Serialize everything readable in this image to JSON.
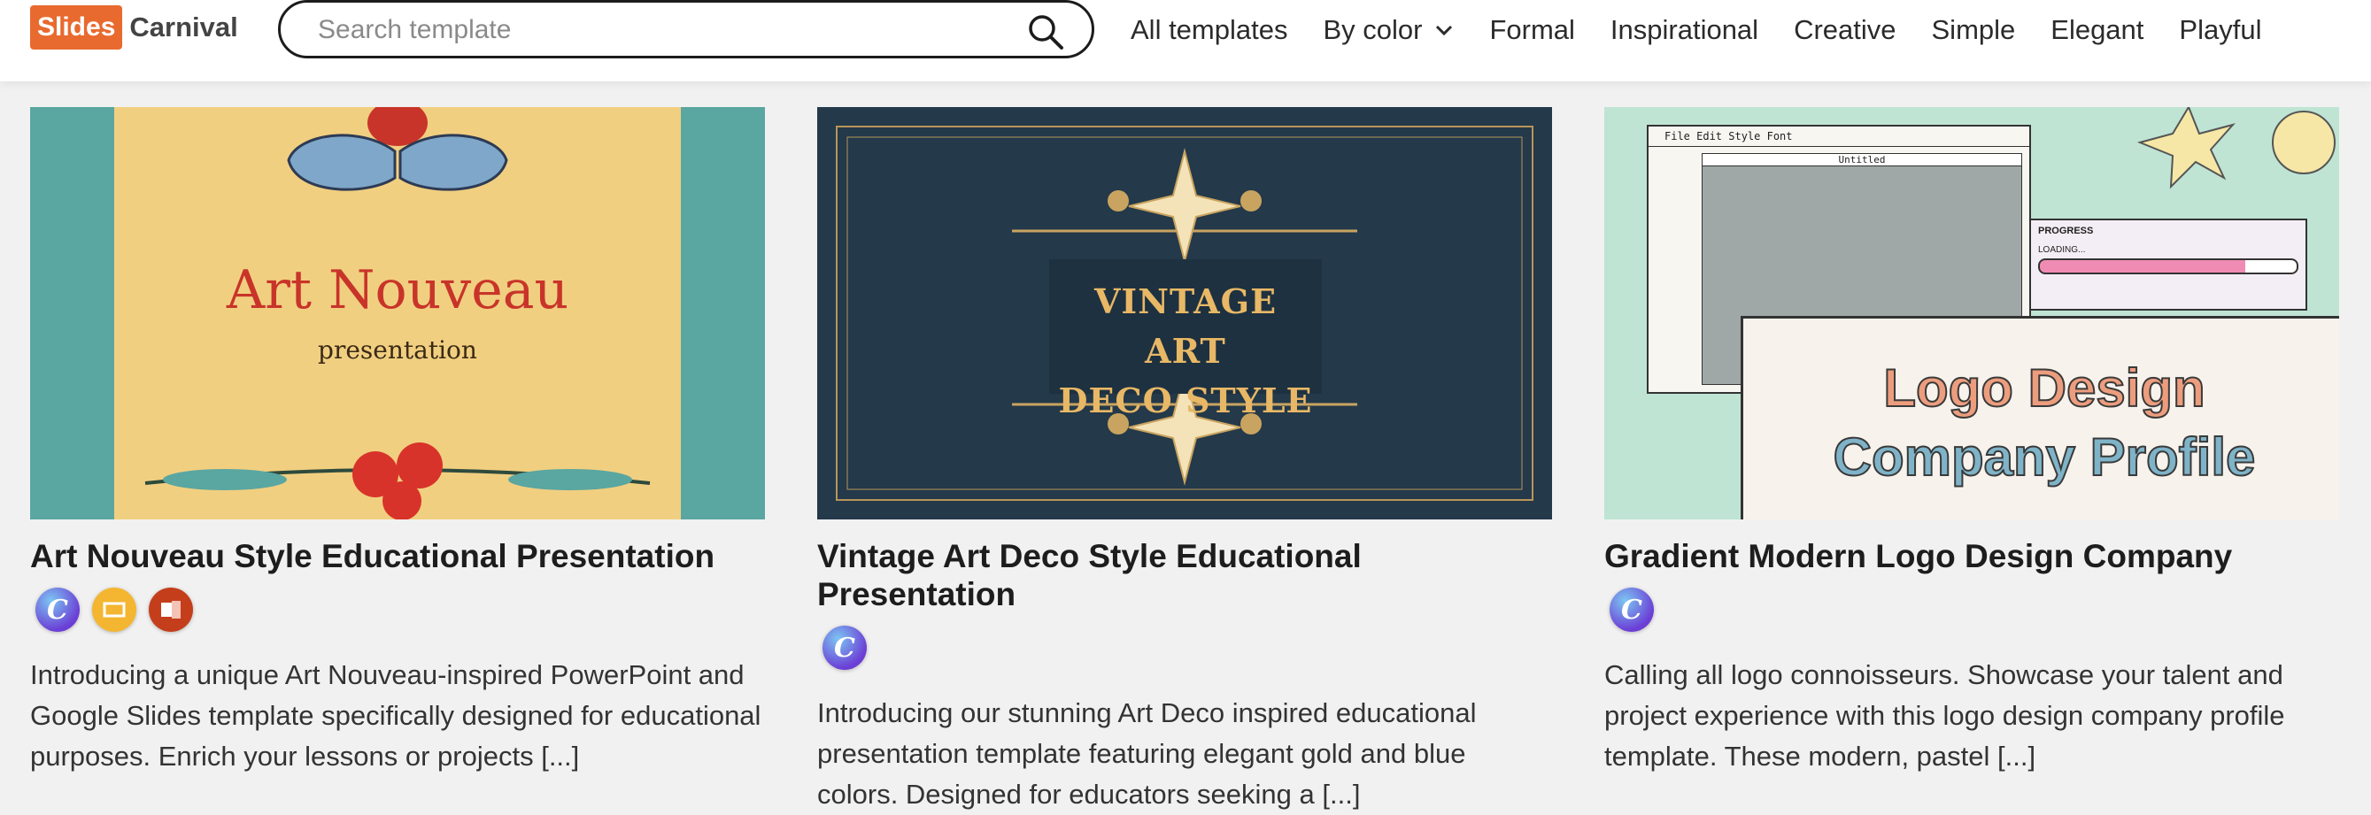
{
  "header": {
    "logo_slides": "Slides",
    "logo_carnival": "Carnival",
    "search_placeholder": "Search template",
    "nav": [
      "All templates",
      "By color",
      "Formal",
      "Inspirational",
      "Creative",
      "Simple",
      "Elegant",
      "Playful"
    ]
  },
  "cards": [
    {
      "title": "Art Nouveau Style Educational Presentation",
      "thumb_title": "Art Nouveau",
      "thumb_subtitle": "presentation",
      "apps": [
        "canva-icon",
        "google-slides-icon",
        "powerpoint-icon"
      ],
      "description": "Introducing a unique Art Nouveau-inspired PowerPoint and Google Slides template specifically designed for educational purposes. Enrich your lessons or projects [...]"
    },
    {
      "title": "Vintage Art Deco Style Educational Presentation",
      "thumb_title_line1": "VINTAGE ART",
      "thumb_title_line2": "DECO STYLE",
      "apps": [
        "canva-icon"
      ],
      "description": "Introducing our stunning Art Deco inspired educational presentation template featuring elegant gold and blue colors. Designed for educators seeking a [...]"
    },
    {
      "title": "Gradient Modern Logo Design Company",
      "thumb_title_line1": "Logo Design",
      "thumb_title_line2": "Company Profile",
      "thumb_menu": "File  Edit  Style  Font",
      "thumb_window": "Untitled",
      "thumb_progress": "PROGRESS",
      "thumb_loading": "LOADING...",
      "apps": [
        "canva-icon"
      ],
      "description": "Calling all logo connoisseurs. Showcase your talent and project experience with this logo design company profile template. These modern, pastel [...]"
    }
  ],
  "colors": {
    "brand": "#e86a2f",
    "canva": "#6b3fd6",
    "google_slides": "#f4b631",
    "powerpoint": "#c43e1c"
  }
}
